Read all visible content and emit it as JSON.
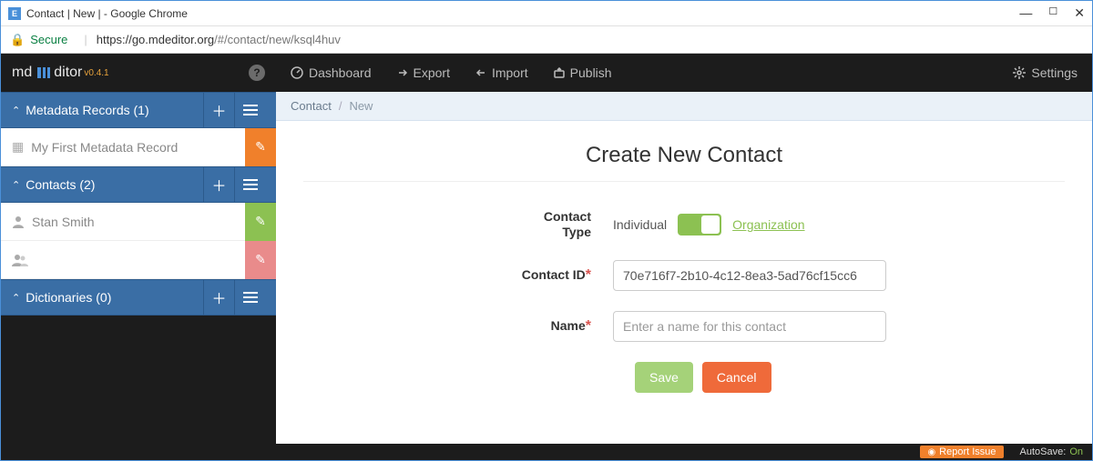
{
  "window": {
    "title": "Contact | New |  - Google Chrome",
    "secure_label": "Secure",
    "url_proto": "https://",
    "url_host": "go.mdeditor.org",
    "url_path": "/#/contact/new/ksql4huv"
  },
  "brand": {
    "md": "md",
    "ditor": "ditor",
    "version": "v0.4.1"
  },
  "sidebar": {
    "sections": [
      {
        "label": "Metadata Records (1)",
        "items": [
          {
            "icon": "grid",
            "label": "My First Metadata Record",
            "badge": "orange"
          }
        ]
      },
      {
        "label": "Contacts (2)",
        "items": [
          {
            "icon": "user",
            "label": "Stan Smith",
            "badge": "green"
          },
          {
            "icon": "users",
            "label": "",
            "badge": "red"
          }
        ]
      },
      {
        "label": "Dictionaries (0)",
        "items": []
      }
    ]
  },
  "topnav": {
    "items": [
      {
        "icon": "dashboard",
        "label": "Dashboard"
      },
      {
        "icon": "export",
        "label": "Export"
      },
      {
        "icon": "import",
        "label": "Import"
      },
      {
        "icon": "publish",
        "label": "Publish"
      }
    ],
    "settings_label": "Settings"
  },
  "breadcrumb": {
    "root": "Contact",
    "current": "New"
  },
  "form": {
    "title": "Create New Contact",
    "contact_type_label": "Contact Type",
    "individual_label": "Individual",
    "organization_label": "Organization",
    "contact_id_label": "Contact ID",
    "contact_id_value": "70e716f7-2b10-4c12-8ea3-5ad76cf15cc6",
    "name_label": "Name",
    "name_placeholder": "Enter a name for this contact",
    "save_label": "Save",
    "cancel_label": "Cancel"
  },
  "footer": {
    "report_label": "Report Issue",
    "autosave_label": "AutoSave:",
    "autosave_state": "On"
  }
}
